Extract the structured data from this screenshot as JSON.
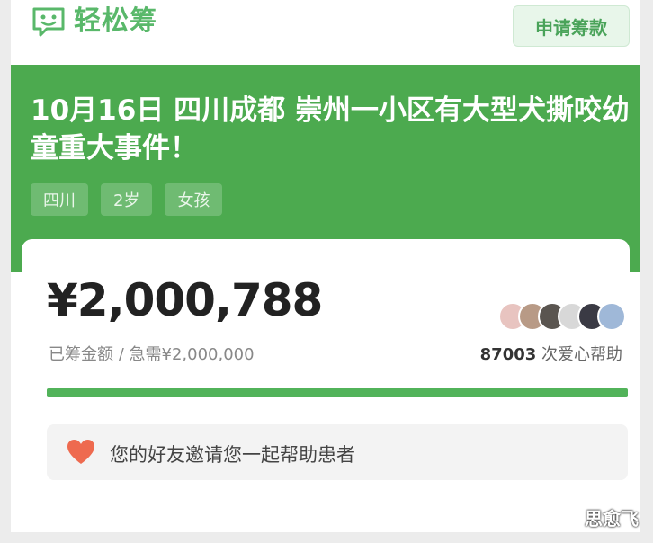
{
  "header": {
    "logo_text": "轻松筹",
    "apply_button": "申请筹款"
  },
  "campaign": {
    "title": "10月16日 四川成都 崇州一小区有大型犬撕咬幼童重大事件！",
    "tags": [
      "四川",
      "2岁",
      "女孩"
    ]
  },
  "stats": {
    "amount": "¥2,000,788",
    "raised_label": "已筹金额 / 急需¥2,000,000",
    "helper_count": "87003",
    "helper_suffix": "次爱心帮助",
    "progress": 1.0
  },
  "invite": {
    "text": "您的好友邀请您一起帮助患者"
  },
  "watermark": "思愈飞",
  "colors": {
    "brand_green": "#4caa4f",
    "progress_green": "#52b35a",
    "heart": "#ee6a4f"
  }
}
